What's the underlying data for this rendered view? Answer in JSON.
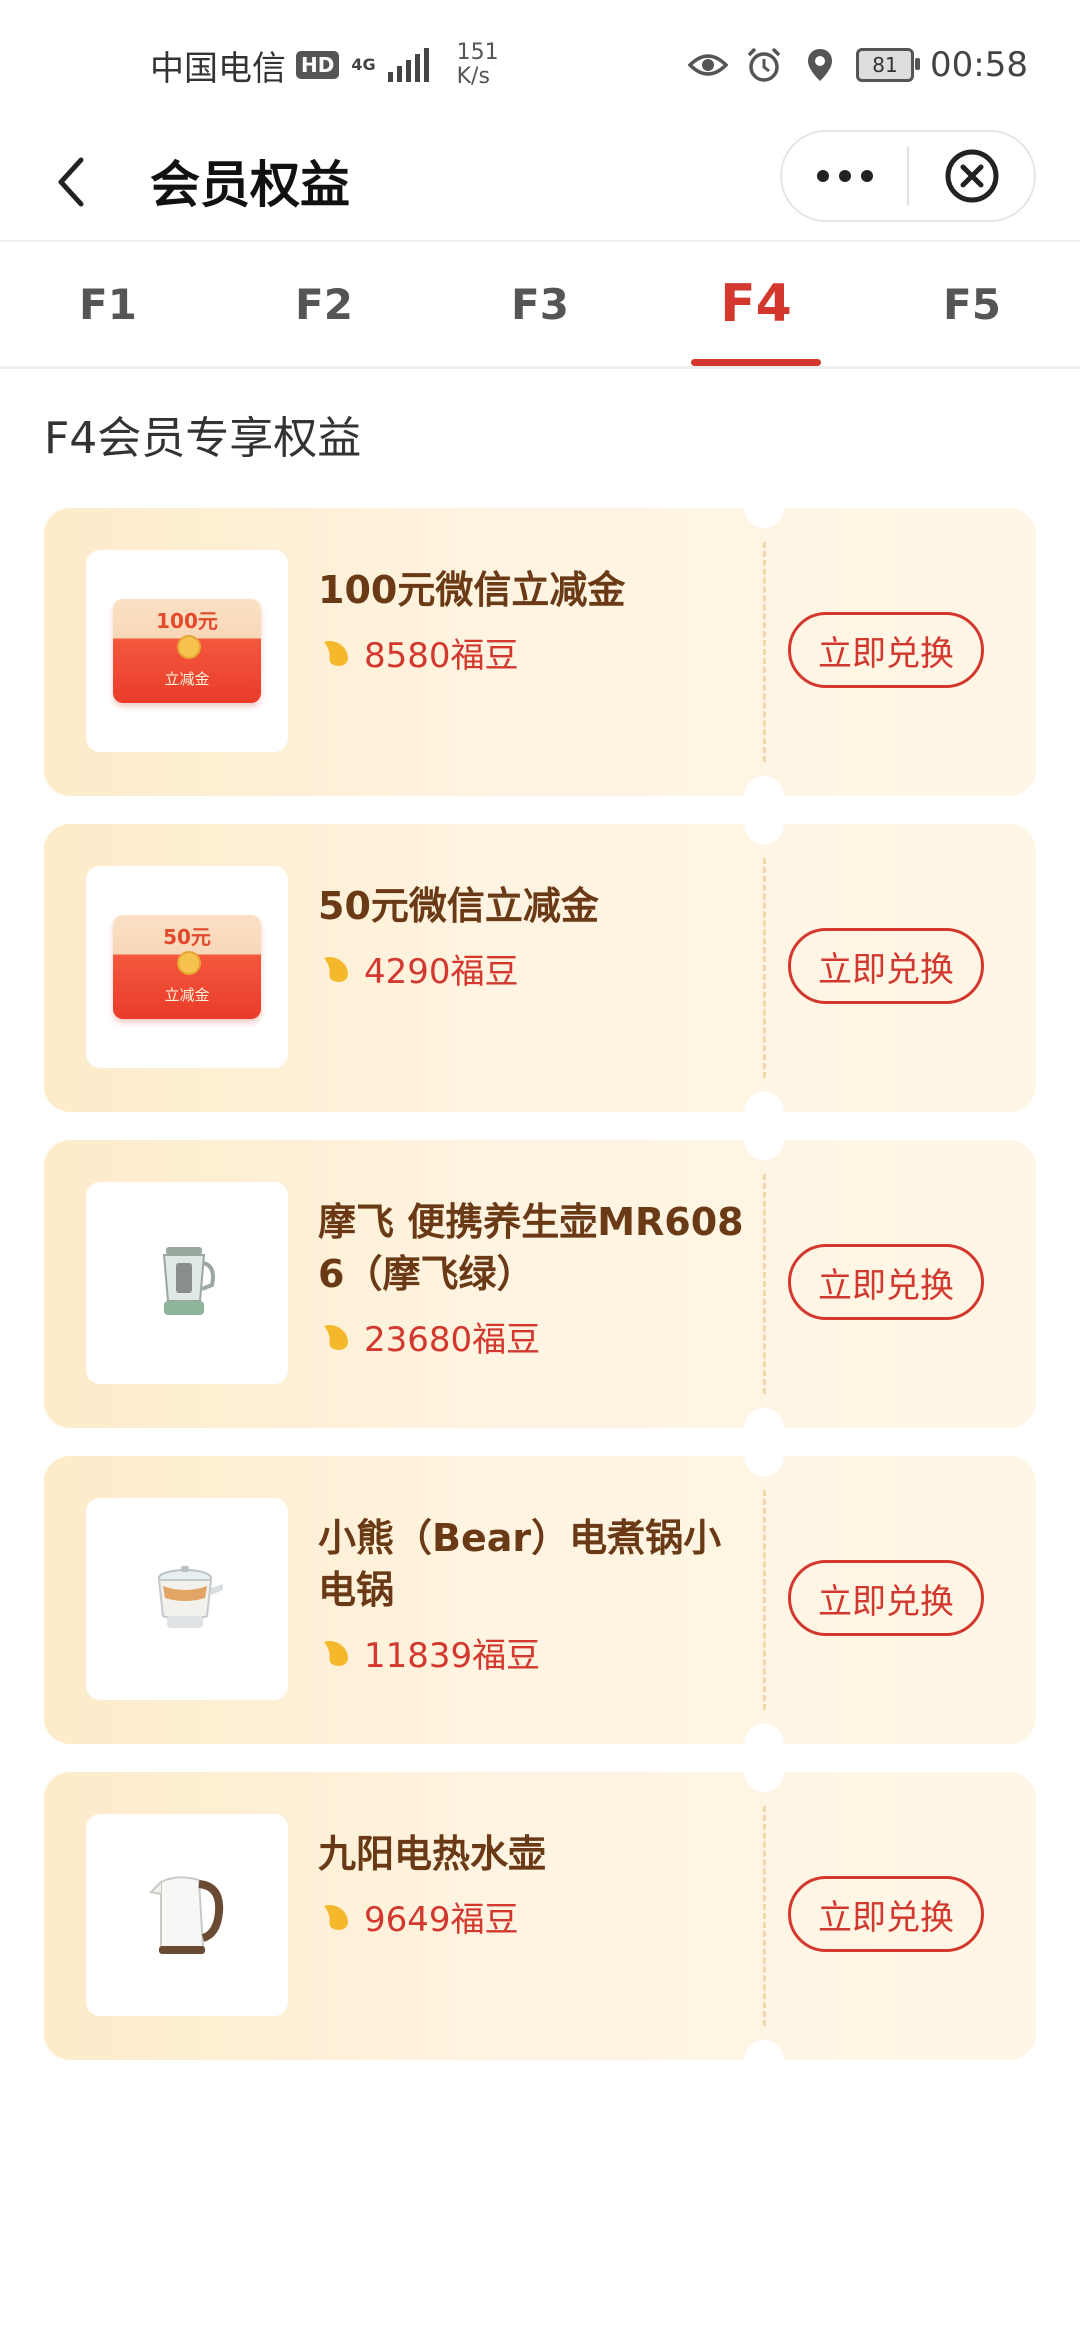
{
  "status_bar": {
    "carrier": "中国电信",
    "hd": "HD",
    "network": "4G",
    "speed_value": "151",
    "speed_unit": "K/s",
    "battery": "81",
    "time": "00:58"
  },
  "header": {
    "title": "会员权益"
  },
  "tabs": [
    {
      "label": "F1",
      "active": false
    },
    {
      "label": "F2",
      "active": false
    },
    {
      "label": "F3",
      "active": false
    },
    {
      "label": "F4",
      "active": true
    },
    {
      "label": "F5",
      "active": false
    }
  ],
  "section_title": "F4会员专享权益",
  "items": [
    {
      "name": "100元微信立减金",
      "price": "8580福豆",
      "button": "立即兑换",
      "thumb": {
        "type": "envelope",
        "amount": "100元",
        "label": "立减金"
      }
    },
    {
      "name": "50元微信立减金",
      "price": "4290福豆",
      "button": "立即兑换",
      "thumb": {
        "type": "envelope",
        "amount": "50元",
        "label": "立减金"
      }
    },
    {
      "name": "摩飞 便携养生壶MR6086（摩飞绿）",
      "price": "23680福豆",
      "button": "立即兑换",
      "thumb": {
        "type": "health-kettle-icon"
      }
    },
    {
      "name": "小熊（Bear）电煮锅小电锅",
      "price": "11839福豆",
      "button": "立即兑换",
      "thumb": {
        "type": "electric-pot-icon"
      }
    },
    {
      "name": "九阳电热水壶",
      "price": "9649福豆",
      "button": "立即兑换",
      "thumb": {
        "type": "electric-kettle-icon"
      }
    }
  ],
  "colors": {
    "accent": "#d3382f",
    "item_name": "#6a3a16",
    "card_bg": "#fff4e1"
  }
}
